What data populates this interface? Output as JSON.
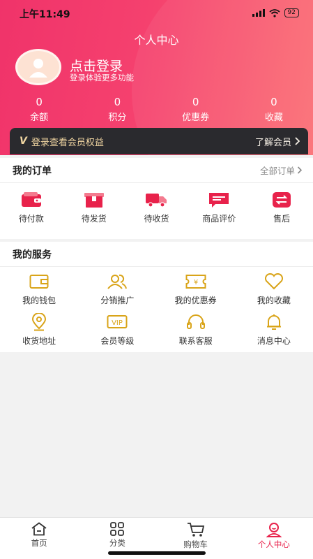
{
  "status_bar": {
    "time": "上午11:49",
    "battery": "92"
  },
  "header": {
    "title": "个人中心",
    "login_title": "点击登录",
    "login_subtitle": "登录体验更多功能"
  },
  "stats": [
    {
      "value": "0",
      "label": "余额"
    },
    {
      "value": "0",
      "label": "积分"
    },
    {
      "value": "0",
      "label": "优惠券"
    },
    {
      "value": "0",
      "label": "收藏"
    }
  ],
  "vip_bar": {
    "mark": "V",
    "text": "登录查看会员权益",
    "link": "了解会员"
  },
  "orders": {
    "title": "我的订单",
    "link": "全部订单",
    "items": [
      {
        "label": "待付款",
        "icon": "wallet-icon"
      },
      {
        "label": "待发货",
        "icon": "box-icon"
      },
      {
        "label": "待收货",
        "icon": "truck-icon"
      },
      {
        "label": "商品评价",
        "icon": "comment-icon"
      },
      {
        "label": "售后",
        "icon": "exchange-icon"
      }
    ]
  },
  "services": {
    "title": "我的服务",
    "items": [
      {
        "label": "我的钱包",
        "icon": "wallet-icon"
      },
      {
        "label": "分销推广",
        "icon": "users-icon"
      },
      {
        "label": "我的优惠券",
        "icon": "coupon-icon"
      },
      {
        "label": "我的收藏",
        "icon": "heart-icon"
      },
      {
        "label": "收货地址",
        "icon": "location-icon"
      },
      {
        "label": "会员等级",
        "icon": "vip-icon",
        "badge": "VIP"
      },
      {
        "label": "联系客服",
        "icon": "headset-icon"
      },
      {
        "label": "消息中心",
        "icon": "bell-icon"
      }
    ]
  },
  "tabbar": {
    "items": [
      {
        "label": "首页",
        "icon": "home-icon"
      },
      {
        "label": "分类",
        "icon": "category-icon"
      },
      {
        "label": "购物车",
        "icon": "cart-icon"
      },
      {
        "label": "个人中心",
        "icon": "profile-icon",
        "active": true
      }
    ]
  },
  "colors": {
    "accent": "#e8224b",
    "gold": "#d9a419",
    "vip_bar": "#2a2a2e"
  }
}
